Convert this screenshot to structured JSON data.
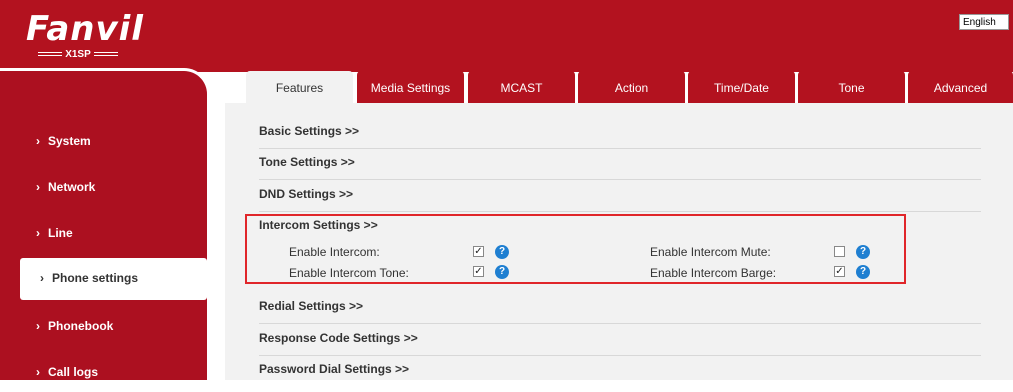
{
  "brand": {
    "name": "Fanvil",
    "model": "X1SP"
  },
  "language": "English",
  "sidebar": {
    "items": [
      {
        "label": "System"
      },
      {
        "label": "Network"
      },
      {
        "label": "Line"
      },
      {
        "label": "Phone settings",
        "active": true
      },
      {
        "label": "Phonebook"
      },
      {
        "label": "Call logs"
      }
    ]
  },
  "tabs": [
    {
      "label": "Features",
      "active": true
    },
    {
      "label": "Media Settings"
    },
    {
      "label": "MCAST"
    },
    {
      "label": "Action"
    },
    {
      "label": "Time/Date"
    },
    {
      "label": "Tone"
    },
    {
      "label": "Advanced"
    }
  ],
  "sections": {
    "basic": "Basic Settings >>",
    "tone": "Tone Settings >>",
    "dnd": "DND Settings >>",
    "intercom": "Intercom Settings >>",
    "redial": "Redial Settings >>",
    "response_code": "Response Code Settings >>",
    "password_dial": "Password Dial Settings >>"
  },
  "intercom": {
    "enable_intercom": {
      "label": "Enable Intercom:",
      "checked": true
    },
    "enable_intercom_tone": {
      "label": "Enable Intercom Tone:",
      "checked": true
    },
    "enable_intercom_mute": {
      "label": "Enable Intercom Mute:",
      "checked": false
    },
    "enable_intercom_barge": {
      "label": "Enable Intercom Barge:",
      "checked": true
    }
  },
  "icons": {
    "help": "question-mark-icon",
    "chevron": "chevron-right-icon"
  },
  "colors": {
    "brand_red": "#b3121f",
    "highlight_border": "#e0262a",
    "help_blue": "#1f7fd1",
    "content_bg": "#f2f2f2"
  }
}
